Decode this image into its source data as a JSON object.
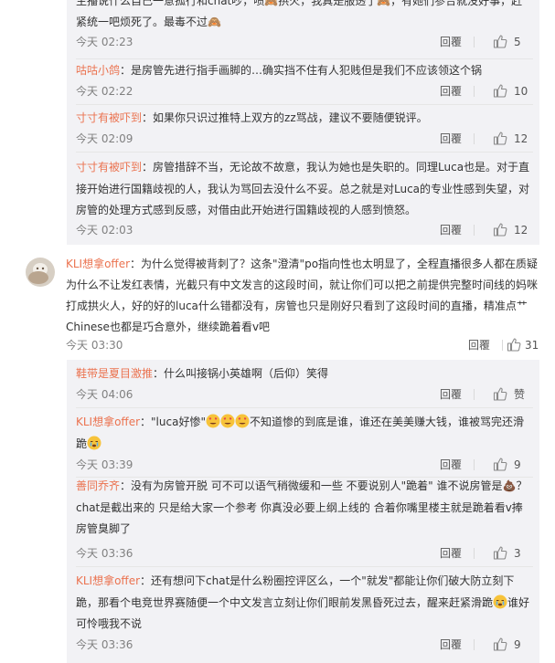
{
  "top_reply": {
    "text_partial": "主播说什么自己一意孤行和chat吵，喷🙈拱火，我真是服透了🙈，有她们参合就没好事，赶紧统一吧烦死了。最毒不过🙈",
    "time": "今天 02:23",
    "likes": "5"
  },
  "replies_top": [
    {
      "user": "咕咕小鸽",
      "text": "：是房管先进行指手画脚的…确实挡不住有人犯贱但是我们不应该领这个锅",
      "time": "今天 02:22",
      "likes": "10"
    },
    {
      "user": "寸寸有被吓到",
      "text": "：如果你只识过推特上双方的zz骂战，建议不要随便锐评。",
      "time": "今天 02:09",
      "likes": "12"
    },
    {
      "user": "寸寸有被吓到",
      "text": "：房管措辞不当，无论故不故意，我认为她也是失职的。同理Luca也是。对于直接开始进行国籍歧视的人，我认为骂回去没什么不妥。总之就是对Luca的专业性感到失望，对房管的处理方式感到反感，对借由此开始进行国籍歧视的人感到愤怒。",
      "time": "今天 02:03",
      "likes": "12"
    }
  ],
  "main_comment": {
    "user": "KLI想拿offer",
    "text": "：为什么觉得被背刺了？这条\"澄清\"po指向性也太明显了，全程直播很多人都在质疑为什么不让发红表情，光截只有中文发言的这段时间，就让你们可以把之前提供完整时间线的妈咪打成拱火人，好的好的luca什么错都没有，房管也只是刚好只看到了这段时间的直播，精准点艹Chinese也都是巧合意外，继续跪着看v吧",
    "time": "今天 03:30",
    "likes": "31"
  },
  "replies_bottom": [
    {
      "user": "鞋带是夏目激推",
      "text": "：什么叫接锅小英雄啊（后仰）笑得",
      "time": "今天 04:06",
      "likes": "赞"
    },
    {
      "user": "KLI想拿offer",
      "text_a": "：\"luca好惨\"",
      "text_b": "不知道惨的到底是谁，谁还在美美赚大钱，谁被骂完还滑跪",
      "time": "今天 03:39",
      "likes": "9"
    },
    {
      "user": "善同乔齐",
      "text": "：没有为房管开脱 可不可以语气稍微缓和一些 不要说别人\"跪着\" 谁不说房管是💩？chat是截出来的 只是给大家一个参考 你真没必要上纲上线的 合着你嘴里楼主就是跪着看v捧房管臭脚了",
      "time": "今天 03:36",
      "likes": "3"
    },
    {
      "user": "KLI想拿offer",
      "text_a": "：还有想问下chat是什么粉圈控评区么，一个\"就发\"都能让你们破大防立刻下跪，那看个电竞世界赛随便一个中文发言立刻让你们眼前发黑昏死过去，醒来赶紧滑跪",
      "text_b": "谁好可怜哦我不说",
      "time": "今天 03:36",
      "likes": "9"
    }
  ],
  "labels": {
    "reply": "回覆"
  },
  "colors": {
    "username": "#eb7350",
    "meta": "#808080",
    "reply_bg": "#f2f2f5"
  }
}
